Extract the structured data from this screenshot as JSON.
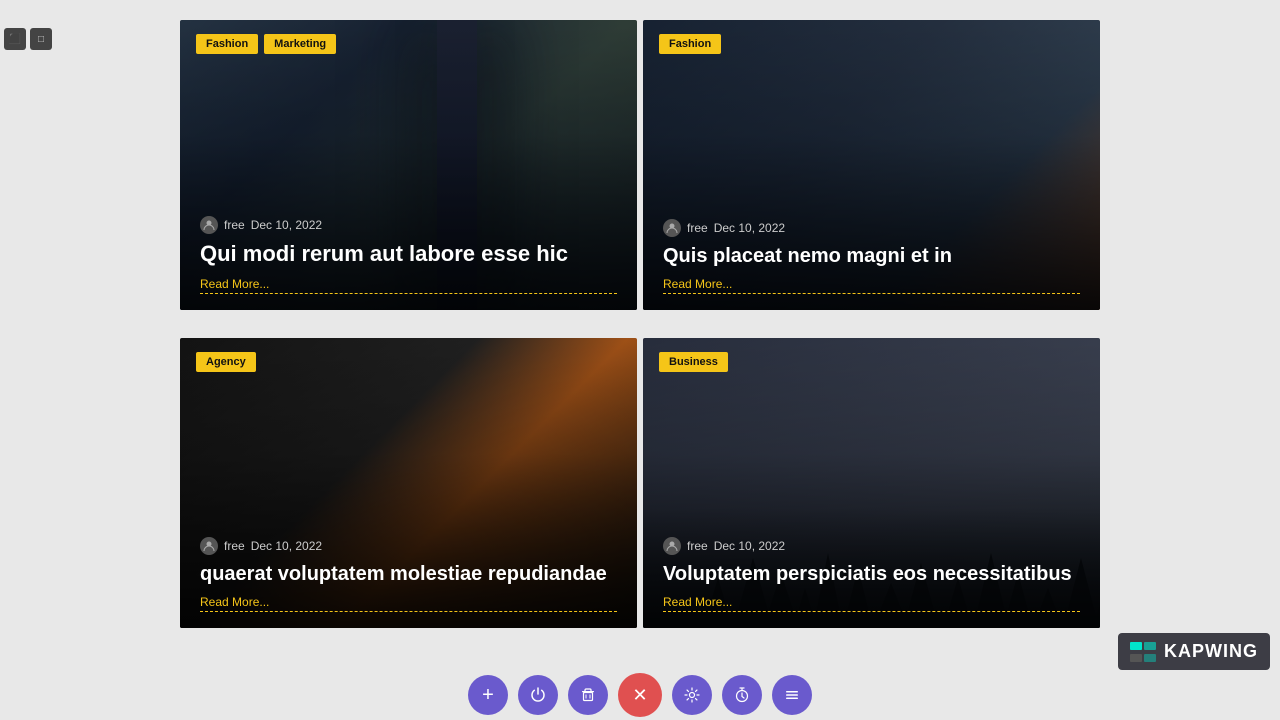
{
  "cards": [
    {
      "id": "card-1",
      "tags": [
        "Fashion",
        "Marketing"
      ],
      "free_label": "free",
      "date": "Dec 10, 2022",
      "title": "Qui modi rerum aut labore esse hic",
      "read_more": "Read More...",
      "bg_class": "card-bg-1"
    },
    {
      "id": "card-2",
      "tags": [
        "Fashion"
      ],
      "free_label": "free",
      "date": "Dec 10, 2022",
      "title": "Quis placeat nemo magni et in",
      "read_more": "Read More...",
      "bg_class": "card-bg-2"
    },
    {
      "id": "card-3",
      "tags": [
        "Agency"
      ],
      "free_label": "free",
      "date": "Dec 10, 2022",
      "title": "quaerat voluptatem molestiae repudiandae",
      "read_more": "Read More...",
      "bg_class": "card-bg-3"
    },
    {
      "id": "card-4",
      "tags": [
        "Business"
      ],
      "free_label": "free",
      "date": "Dec 10, 2022",
      "title": "Voluptatem perspiciatis eos necessitatibus",
      "read_more": "Read More...",
      "bg_class": "card-bg-4"
    }
  ],
  "toolbar": {
    "buttons": [
      {
        "icon": "+",
        "type": "normal",
        "name": "add-button"
      },
      {
        "icon": "⏻",
        "type": "normal",
        "name": "power-button"
      },
      {
        "icon": "🗑",
        "type": "normal",
        "name": "delete-button"
      },
      {
        "icon": "✕",
        "type": "close",
        "name": "close-button"
      },
      {
        "icon": "⚙",
        "type": "normal",
        "name": "settings-button"
      },
      {
        "icon": "⏱",
        "type": "normal",
        "name": "timer-button"
      },
      {
        "icon": "≡",
        "type": "normal",
        "name": "menu-button"
      }
    ]
  },
  "left_panel": {
    "indicators": [
      {
        "id": 1
      },
      {
        "id": 2
      }
    ]
  },
  "watermark": {
    "text": "KAPWING"
  }
}
